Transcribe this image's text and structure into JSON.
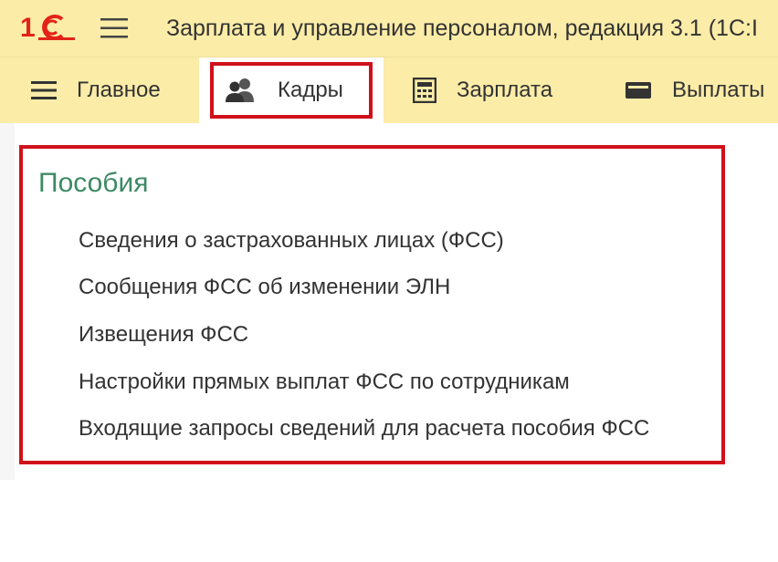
{
  "app": {
    "logo_text": "1С",
    "title": "Зарплата и управление персоналом, редакция 3.1 (1С:I"
  },
  "sections": {
    "main": {
      "label": "Главное",
      "icon": "menu-lines-icon"
    },
    "kadry": {
      "label": "Кадры",
      "icon": "people-icon"
    },
    "zarplata": {
      "label": "Зарплата",
      "icon": "calculator-icon"
    },
    "vyplaty": {
      "label": "Выплаты",
      "icon": "wallet-icon"
    }
  },
  "group": {
    "title": "Пособия",
    "items": [
      {
        "label": "Сведения о застрахованных лицах (ФСС)"
      },
      {
        "label": "Сообщения ФСС об изменении ЭЛН"
      },
      {
        "label": "Извещения ФСС"
      },
      {
        "label": "Настройки прямых выплат ФСС по сотрудникам"
      },
      {
        "label": "Входящие запросы сведений для расчета пособия ФСС"
      }
    ]
  },
  "colors": {
    "panel_yellow": "#fbeca8",
    "highlight_red": "#d0111b",
    "group_title_green": "#3c8a63",
    "logo_red": "#e2231a"
  }
}
